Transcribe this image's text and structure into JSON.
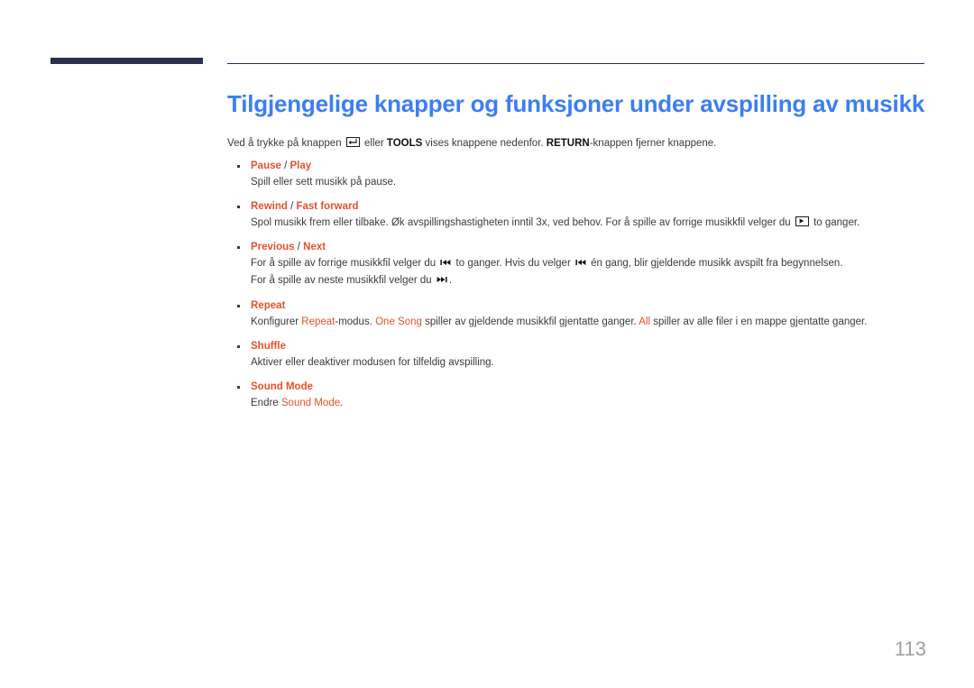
{
  "document": {
    "title": "Tilgjengelige knapper og funksjoner under avspilling av musikk",
    "page_number": "113",
    "accent_blue": "#3b7ef5",
    "accent_orange": "#e8512b",
    "rule_navy": "#2b3050"
  },
  "intro": {
    "part1": "Ved å trykke på knappen ",
    "icon1": "enter-key-icon",
    "part2": " eller ",
    "bold1": "TOOLS",
    "part3": " vises knappene nedenfor. ",
    "bold2": "RETURN",
    "part4": "-knappen fjerner knappene."
  },
  "bullets": [
    {
      "label_a": "Pause",
      "separator": " / ",
      "label_b": "Play",
      "desc": "Spill eller sett musikk på pause.",
      "lines": [
        {
          "text": "Spill eller sett musikk på pause."
        }
      ]
    },
    {
      "label_a": "Rewind",
      "separator": " / ",
      "label_b": "Fast forward",
      "desc_part1": "Spol musikk frem eller tilbake. Øk avspillingshastigheten inntil 3x, ved behov. For å spille av forrige musikkfil velger du ",
      "icon": "play-key-icon",
      "desc_part2": " to ganger."
    },
    {
      "label_a": "Previous",
      "separator": " / ",
      "label_b": "Next",
      "line1_part1": "For å spille av forrige musikkfil velger du ",
      "line1_icon1": "previous-track-icon",
      "line1_part2": " to ganger. Hvis du velger ",
      "line1_icon2": "previous-track-icon",
      "line1_part3": " én gang, blir gjeldende musikk avspilt fra begynnelsen.",
      "line2_part1": "For å spille av neste musikkfil velger du ",
      "line2_icon": "next-track-icon",
      "line2_part2": "."
    },
    {
      "label_a": "Repeat",
      "desc_part1": "Konfigurer ",
      "hl1": "Repeat",
      "desc_part2": "-modus. ",
      "hl2": "One Song",
      "desc_part3": " spiller av gjeldende musikkfil gjentatte ganger. ",
      "hl3": "All",
      "desc_part4": " spiller av alle filer i en mappe gjentatte ganger."
    },
    {
      "label_a": "Shuffle",
      "desc": "Aktiver eller deaktiver modusen for tilfeldig avspilling."
    },
    {
      "label_a": "Sound Mode",
      "desc_part1": "Endre ",
      "hl1": "Sound Mode",
      "desc_part2": "."
    }
  ]
}
